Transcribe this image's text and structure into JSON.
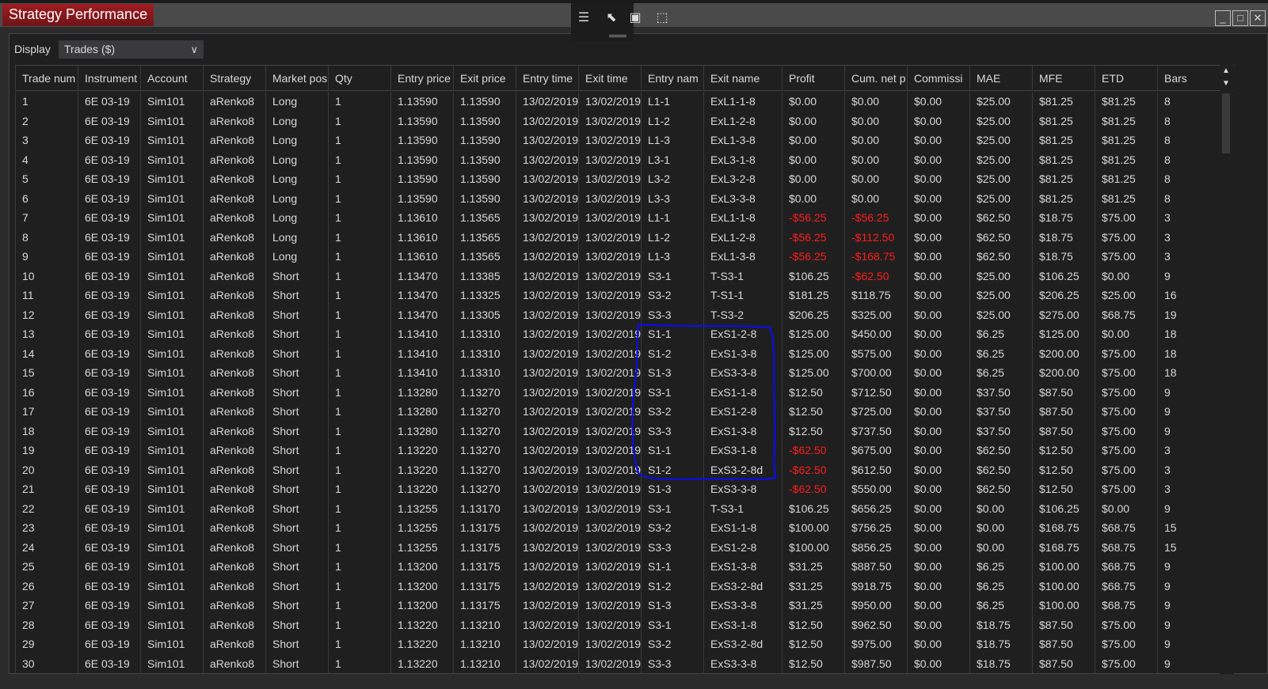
{
  "window": {
    "title": "Strategy Performance",
    "toolbar_icons": [
      "properties-icon",
      "pointer-icon",
      "window-icon",
      "select-pointer-icon"
    ],
    "controls": [
      "minimize",
      "maximize",
      "close"
    ]
  },
  "display": {
    "label": "Display",
    "value": "Trades ($)"
  },
  "colors": {
    "title_bg": "#a01c22",
    "negative": "#ff1c1c",
    "annotation": "#0000ff"
  },
  "columns": [
    "Trade num",
    "Instrument",
    "Account",
    "Strategy",
    "Market pos",
    "Qty",
    "Entry price",
    "Exit price",
    "Entry time",
    "Exit time",
    "Entry nam",
    "Exit name",
    "Profit",
    "Cum. net p",
    "Commissi",
    "MAE",
    "MFE",
    "ETD",
    "Bars"
  ],
  "rows": [
    [
      "1",
      "6E 03-19",
      "Sim101",
      "aRenko8",
      "Long",
      "1",
      "1.13590",
      "1.13590",
      "13/02/2019",
      "13/02/2019",
      "L1-1",
      "ExL1-1-8",
      "$0.00",
      "$0.00",
      "$0.00",
      "$25.00",
      "$81.25",
      "$81.25",
      "8"
    ],
    [
      "2",
      "6E 03-19",
      "Sim101",
      "aRenko8",
      "Long",
      "1",
      "1.13590",
      "1.13590",
      "13/02/2019",
      "13/02/2019",
      "L1-2",
      "ExL1-2-8",
      "$0.00",
      "$0.00",
      "$0.00",
      "$25.00",
      "$81.25",
      "$81.25",
      "8"
    ],
    [
      "3",
      "6E 03-19",
      "Sim101",
      "aRenko8",
      "Long",
      "1",
      "1.13590",
      "1.13590",
      "13/02/2019",
      "13/02/2019",
      "L1-3",
      "ExL1-3-8",
      "$0.00",
      "$0.00",
      "$0.00",
      "$25.00",
      "$81.25",
      "$81.25",
      "8"
    ],
    [
      "4",
      "6E 03-19",
      "Sim101",
      "aRenko8",
      "Long",
      "1",
      "1.13590",
      "1.13590",
      "13/02/2019",
      "13/02/2019",
      "L3-1",
      "ExL3-1-8",
      "$0.00",
      "$0.00",
      "$0.00",
      "$25.00",
      "$81.25",
      "$81.25",
      "8"
    ],
    [
      "5",
      "6E 03-19",
      "Sim101",
      "aRenko8",
      "Long",
      "1",
      "1.13590",
      "1.13590",
      "13/02/2019",
      "13/02/2019",
      "L3-2",
      "ExL3-2-8",
      "$0.00",
      "$0.00",
      "$0.00",
      "$25.00",
      "$81.25",
      "$81.25",
      "8"
    ],
    [
      "6",
      "6E 03-19",
      "Sim101",
      "aRenko8",
      "Long",
      "1",
      "1.13590",
      "1.13590",
      "13/02/2019",
      "13/02/2019",
      "L3-3",
      "ExL3-3-8",
      "$0.00",
      "$0.00",
      "$0.00",
      "$25.00",
      "$81.25",
      "$81.25",
      "8"
    ],
    [
      "7",
      "6E 03-19",
      "Sim101",
      "aRenko8",
      "Long",
      "1",
      "1.13610",
      "1.13565",
      "13/02/2019",
      "13/02/2019",
      "L1-1",
      "ExL1-1-8",
      "-$56.25",
      "-$56.25",
      "$0.00",
      "$62.50",
      "$18.75",
      "$75.00",
      "3"
    ],
    [
      "8",
      "6E 03-19",
      "Sim101",
      "aRenko8",
      "Long",
      "1",
      "1.13610",
      "1.13565",
      "13/02/2019",
      "13/02/2019",
      "L1-2",
      "ExL1-2-8",
      "-$56.25",
      "-$112.50",
      "$0.00",
      "$62.50",
      "$18.75",
      "$75.00",
      "3"
    ],
    [
      "9",
      "6E 03-19",
      "Sim101",
      "aRenko8",
      "Long",
      "1",
      "1.13610",
      "1.13565",
      "13/02/2019",
      "13/02/2019",
      "L1-3",
      "ExL1-3-8",
      "-$56.25",
      "-$168.75",
      "$0.00",
      "$62.50",
      "$18.75",
      "$75.00",
      "3"
    ],
    [
      "10",
      "6E 03-19",
      "Sim101",
      "aRenko8",
      "Short",
      "1",
      "1.13470",
      "1.13385",
      "13/02/2019",
      "13/02/2019",
      "S3-1",
      "T-S3-1",
      "$106.25",
      "-$62.50",
      "$0.00",
      "$25.00",
      "$106.25",
      "$0.00",
      "9"
    ],
    [
      "11",
      "6E 03-19",
      "Sim101",
      "aRenko8",
      "Short",
      "1",
      "1.13470",
      "1.13325",
      "13/02/2019",
      "13/02/2019",
      "S3-2",
      "T-S1-1",
      "$181.25",
      "$118.75",
      "$0.00",
      "$25.00",
      "$206.25",
      "$25.00",
      "16"
    ],
    [
      "12",
      "6E 03-19",
      "Sim101",
      "aRenko8",
      "Short",
      "1",
      "1.13470",
      "1.13305",
      "13/02/2019",
      "13/02/2019",
      "S3-3",
      "T-S3-2",
      "$206.25",
      "$325.00",
      "$0.00",
      "$25.00",
      "$275.00",
      "$68.75",
      "19"
    ],
    [
      "13",
      "6E 03-19",
      "Sim101",
      "aRenko8",
      "Short",
      "1",
      "1.13410",
      "1.13310",
      "13/02/2019",
      "13/02/2019",
      "S1-1",
      "ExS1-2-8",
      "$125.00",
      "$450.00",
      "$0.00",
      "$6.25",
      "$125.00",
      "$0.00",
      "18"
    ],
    [
      "14",
      "6E 03-19",
      "Sim101",
      "aRenko8",
      "Short",
      "1",
      "1.13410",
      "1.13310",
      "13/02/2019",
      "13/02/2019",
      "S1-2",
      "ExS1-3-8",
      "$125.00",
      "$575.00",
      "$0.00",
      "$6.25",
      "$200.00",
      "$75.00",
      "18"
    ],
    [
      "15",
      "6E 03-19",
      "Sim101",
      "aRenko8",
      "Short",
      "1",
      "1.13410",
      "1.13310",
      "13/02/2019",
      "13/02/2019",
      "S1-3",
      "ExS3-3-8",
      "$125.00",
      "$700.00",
      "$0.00",
      "$6.25",
      "$200.00",
      "$75.00",
      "18"
    ],
    [
      "16",
      "6E 03-19",
      "Sim101",
      "aRenko8",
      "Short",
      "1",
      "1.13280",
      "1.13270",
      "13/02/2019",
      "13/02/2019",
      "S3-1",
      "ExS1-1-8",
      "$12.50",
      "$712.50",
      "$0.00",
      "$37.50",
      "$87.50",
      "$75.00",
      "9"
    ],
    [
      "17",
      "6E 03-19",
      "Sim101",
      "aRenko8",
      "Short",
      "1",
      "1.13280",
      "1.13270",
      "13/02/2019",
      "13/02/2019",
      "S3-2",
      "ExS1-2-8",
      "$12.50",
      "$725.00",
      "$0.00",
      "$37.50",
      "$87.50",
      "$75.00",
      "9"
    ],
    [
      "18",
      "6E 03-19",
      "Sim101",
      "aRenko8",
      "Short",
      "1",
      "1.13280",
      "1.13270",
      "13/02/2019",
      "13/02/2019",
      "S3-3",
      "ExS1-3-8",
      "$12.50",
      "$737.50",
      "$0.00",
      "$37.50",
      "$87.50",
      "$75.00",
      "9"
    ],
    [
      "19",
      "6E 03-19",
      "Sim101",
      "aRenko8",
      "Short",
      "1",
      "1.13220",
      "1.13270",
      "13/02/2019",
      "13/02/2019",
      "S1-1",
      "ExS3-1-8",
      "-$62.50",
      "$675.00",
      "$0.00",
      "$62.50",
      "$12.50",
      "$75.00",
      "3"
    ],
    [
      "20",
      "6E 03-19",
      "Sim101",
      "aRenko8",
      "Short",
      "1",
      "1.13220",
      "1.13270",
      "13/02/2019",
      "13/02/2019",
      "S1-2",
      "ExS3-2-8d",
      "-$62.50",
      "$612.50",
      "$0.00",
      "$62.50",
      "$12.50",
      "$75.00",
      "3"
    ],
    [
      "21",
      "6E 03-19",
      "Sim101",
      "aRenko8",
      "Short",
      "1",
      "1.13220",
      "1.13270",
      "13/02/2019",
      "13/02/2019",
      "S1-3",
      "ExS3-3-8",
      "-$62.50",
      "$550.00",
      "$0.00",
      "$62.50",
      "$12.50",
      "$75.00",
      "3"
    ],
    [
      "22",
      "6E 03-19",
      "Sim101",
      "aRenko8",
      "Short",
      "1",
      "1.13255",
      "1.13170",
      "13/02/2019",
      "13/02/2019",
      "S3-1",
      "T-S3-1",
      "$106.25",
      "$656.25",
      "$0.00",
      "$0.00",
      "$106.25",
      "$0.00",
      "9"
    ],
    [
      "23",
      "6E 03-19",
      "Sim101",
      "aRenko8",
      "Short",
      "1",
      "1.13255",
      "1.13175",
      "13/02/2019",
      "13/02/2019",
      "S3-2",
      "ExS1-1-8",
      "$100.00",
      "$756.25",
      "$0.00",
      "$0.00",
      "$168.75",
      "$68.75",
      "15"
    ],
    [
      "24",
      "6E 03-19",
      "Sim101",
      "aRenko8",
      "Short",
      "1",
      "1.13255",
      "1.13175",
      "13/02/2019",
      "13/02/2019",
      "S3-3",
      "ExS1-2-8",
      "$100.00",
      "$856.25",
      "$0.00",
      "$0.00",
      "$168.75",
      "$68.75",
      "15"
    ],
    [
      "25",
      "6E 03-19",
      "Sim101",
      "aRenko8",
      "Short",
      "1",
      "1.13200",
      "1.13175",
      "13/02/2019",
      "13/02/2019",
      "S1-1",
      "ExS1-3-8",
      "$31.25",
      "$887.50",
      "$0.00",
      "$6.25",
      "$100.00",
      "$68.75",
      "9"
    ],
    [
      "26",
      "6E 03-19",
      "Sim101",
      "aRenko8",
      "Short",
      "1",
      "1.13200",
      "1.13175",
      "13/02/2019",
      "13/02/2019",
      "S1-2",
      "ExS3-2-8d",
      "$31.25",
      "$918.75",
      "$0.00",
      "$6.25",
      "$100.00",
      "$68.75",
      "9"
    ],
    [
      "27",
      "6E 03-19",
      "Sim101",
      "aRenko8",
      "Short",
      "1",
      "1.13200",
      "1.13175",
      "13/02/2019",
      "13/02/2019",
      "S1-3",
      "ExS3-3-8",
      "$31.25",
      "$950.00",
      "$0.00",
      "$6.25",
      "$100.00",
      "$68.75",
      "9"
    ],
    [
      "28",
      "6E 03-19",
      "Sim101",
      "aRenko8",
      "Short",
      "1",
      "1.13220",
      "1.13210",
      "13/02/2019",
      "13/02/2019",
      "S3-1",
      "ExS3-1-8",
      "$12.50",
      "$962.50",
      "$0.00",
      "$18.75",
      "$87.50",
      "$75.00",
      "9"
    ],
    [
      "29",
      "6E 03-19",
      "Sim101",
      "aRenko8",
      "Short",
      "1",
      "1.13220",
      "1.13210",
      "13/02/2019",
      "13/02/2019",
      "S3-2",
      "ExS3-2-8d",
      "$12.50",
      "$975.00",
      "$0.00",
      "$18.75",
      "$87.50",
      "$75.00",
      "9"
    ],
    [
      "30",
      "6E 03-19",
      "Sim101",
      "aRenko8",
      "Short",
      "1",
      "1.13220",
      "1.13210",
      "13/02/2019",
      "13/02/2019",
      "S3-3",
      "ExS3-3-8",
      "$12.50",
      "$987.50",
      "$0.00",
      "$18.75",
      "$87.50",
      "$75.00",
      "9"
    ]
  ]
}
